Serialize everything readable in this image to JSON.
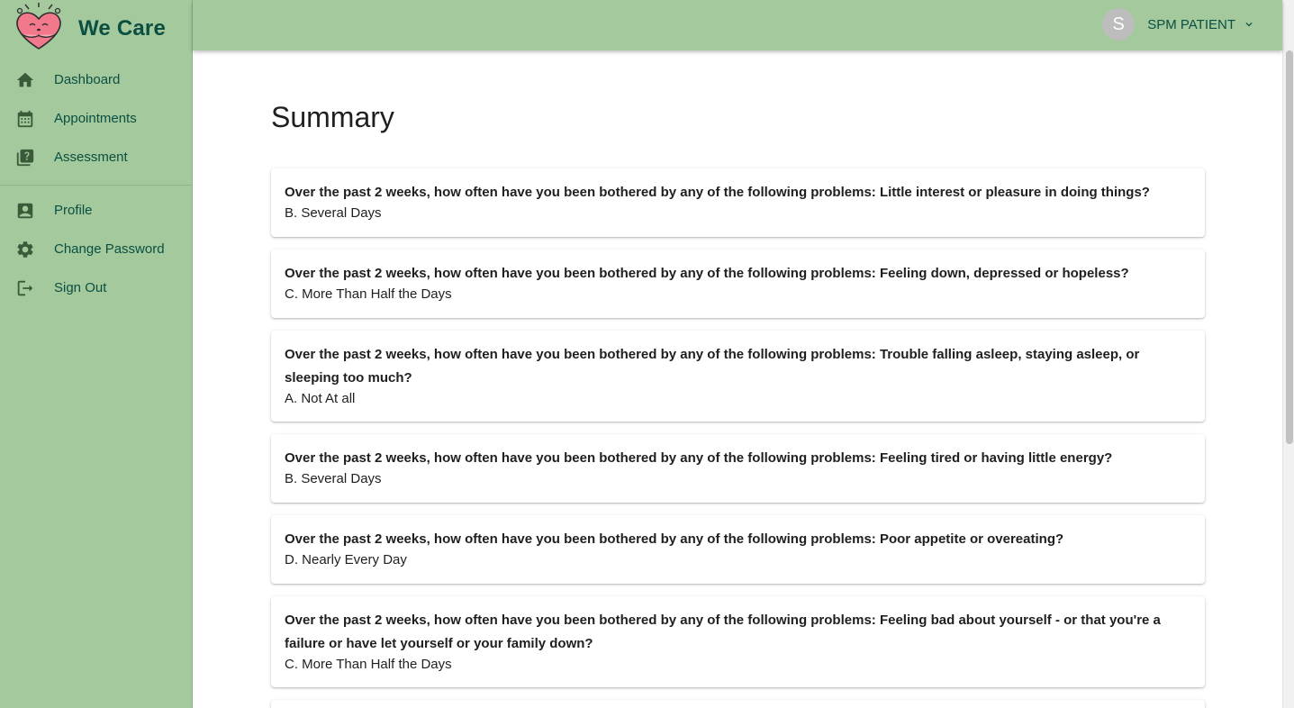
{
  "brand": {
    "name": "We Care",
    "logo_icon": "heart-mascot-icon"
  },
  "sidebar": {
    "primary": [
      {
        "label": "Dashboard",
        "icon": "home-icon"
      },
      {
        "label": "Appointments",
        "icon": "calendar-icon"
      },
      {
        "label": "Assessment",
        "icon": "quiz-icon"
      }
    ],
    "secondary": [
      {
        "label": "Profile",
        "icon": "profile-icon"
      },
      {
        "label": "Change Password",
        "icon": "gear-icon"
      },
      {
        "label": "Sign Out",
        "icon": "sign-out-icon"
      }
    ]
  },
  "header": {
    "user": {
      "avatar_initial": "S",
      "name": "SPM PATIENT"
    }
  },
  "main": {
    "title": "Summary",
    "items": [
      {
        "question": "Over the past 2 weeks, how often have you been bothered by any of the following problems: Little interest or pleasure in doing things?",
        "answer": "B. Several Days"
      },
      {
        "question": "Over the past 2 weeks, how often have you been bothered by any of the following problems: Feeling down, depressed or hopeless?",
        "answer": "C. More Than Half the Days"
      },
      {
        "question": "Over the past 2 weeks, how often have you been bothered by any of the following problems: Trouble falling asleep, staying asleep, or sleeping too much?",
        "answer": "A. Not At all"
      },
      {
        "question": "Over the past 2 weeks, how often have you been bothered by any of the following problems: Feeling tired or having little energy?",
        "answer": "B. Several Days"
      },
      {
        "question": "Over the past 2 weeks, how often have you been bothered by any of the following problems: Poor appetite or overeating?",
        "answer": "D. Nearly Every Day"
      },
      {
        "question": "Over the past 2 weeks, how often have you been bothered by any of the following problems: Feeling bad about yourself - or that you're a failure or have let yourself or your family down?",
        "answer": "C. More Than Half the Days"
      }
    ]
  },
  "colors": {
    "sidebar_bg": "#a3c99c",
    "accent_text": "#0b4f43",
    "icon": "#3a5a3a"
  }
}
